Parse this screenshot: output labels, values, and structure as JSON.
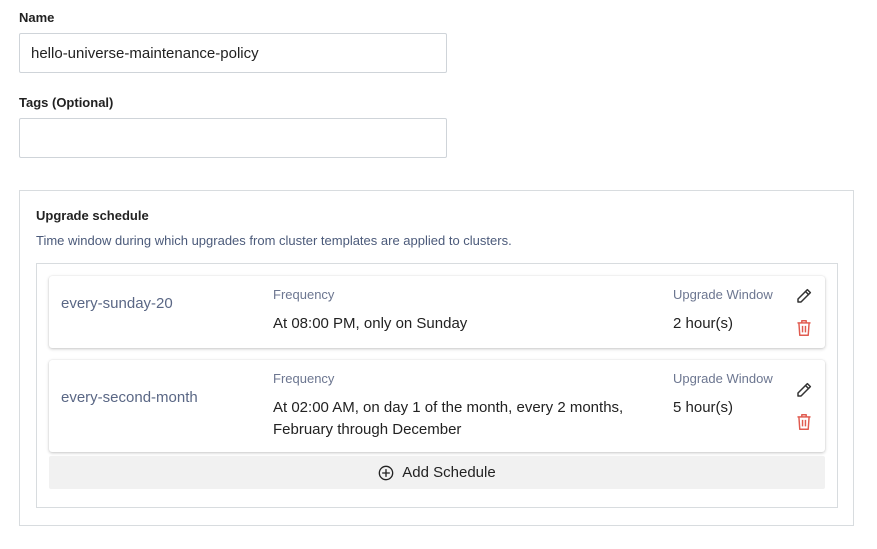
{
  "form": {
    "name_label": "Name",
    "name_value": "hello-universe-maintenance-policy",
    "tags_label": "Tags (Optional)",
    "tags_value": ""
  },
  "upgrade_schedule": {
    "title": "Upgrade schedule",
    "description": "Time window during which upgrades from cluster templates are applied to clusters.",
    "frequency_label": "Frequency",
    "window_label": "Upgrade Window",
    "schedules": [
      {
        "name": "every-sunday-20",
        "frequency": "At 08:00 PM, only on Sunday",
        "window": "2 hour(s)"
      },
      {
        "name": "every-second-month",
        "frequency_line1": "At 02:00 AM, on day 1 of the month, every 2 months,",
        "frequency_line2": "February through December",
        "window": "5 hour(s)"
      }
    ],
    "add_label": "Add Schedule"
  },
  "icons": {
    "edit": "pencil-icon",
    "delete": "trash-icon",
    "add": "plus-circle-icon"
  },
  "colors": {
    "delete_icon": "#e05a4f",
    "schedule_name": "#5a6785",
    "description": "#4b5a7a"
  }
}
